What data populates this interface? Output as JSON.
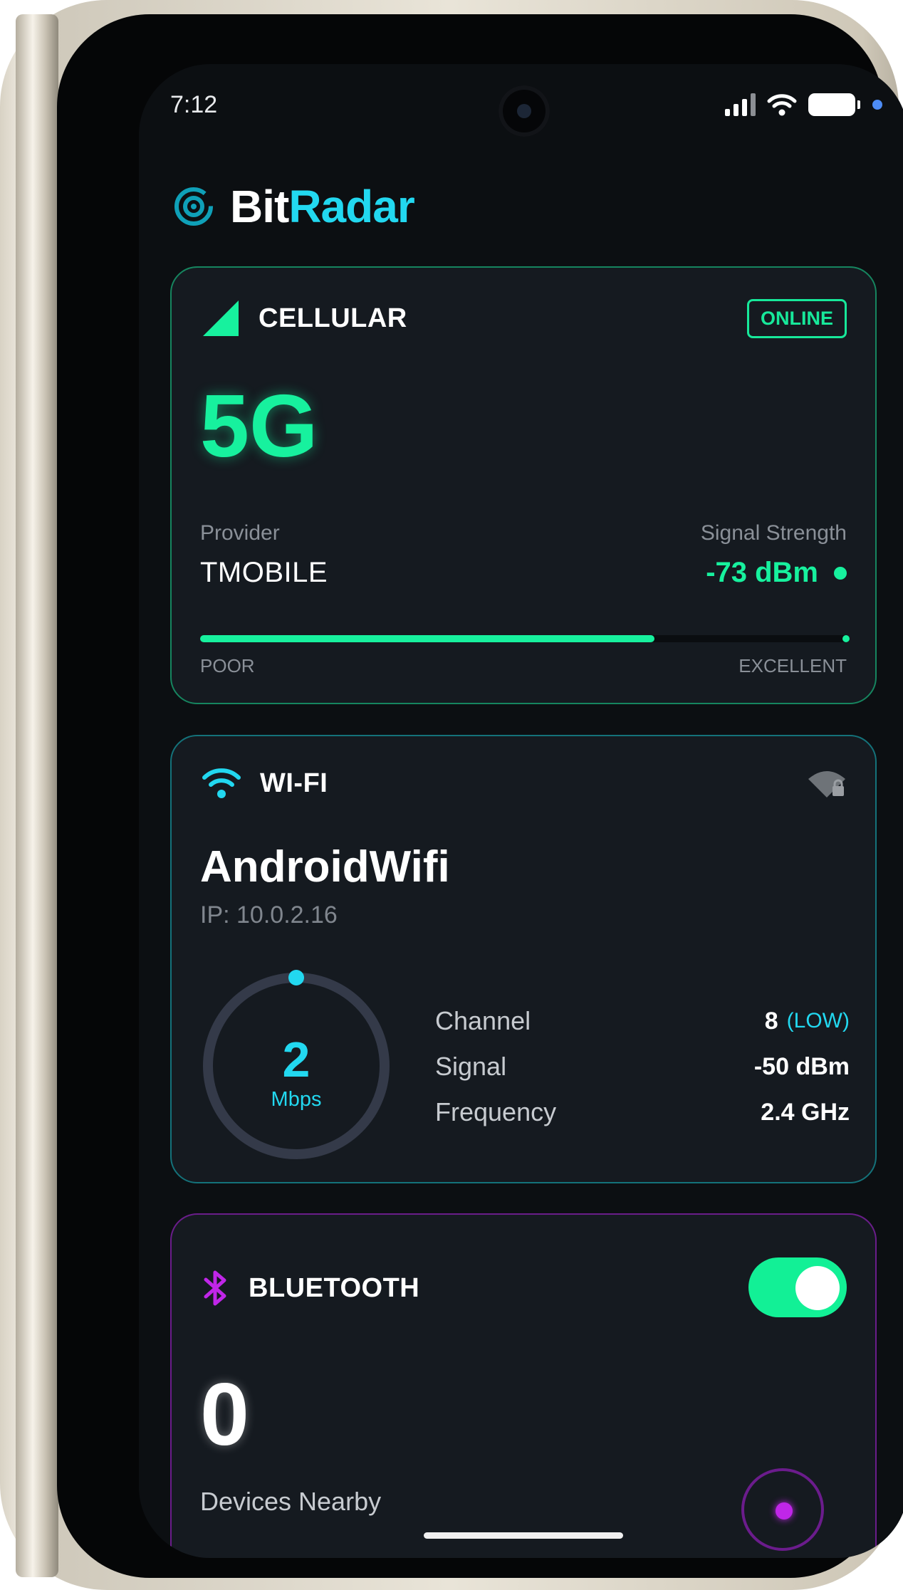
{
  "status_bar": {
    "time": "7:12"
  },
  "app": {
    "title_part1": "Bit",
    "title_part2": "Radar",
    "accent_color": "#22d8f0",
    "logo_icon": "radar-icon"
  },
  "cellular": {
    "title": "CELLULAR",
    "status_badge": "ONLINE",
    "network_type": "5G",
    "provider_label": "Provider",
    "provider_value": "TMOBILE",
    "signal_label": "Signal Strength",
    "signal_value": "-73 dBm",
    "signal_quality_fraction": 0.7,
    "scale_min_label": "POOR",
    "scale_max_label": "EXCELLENT",
    "accent_color": "#17f19e"
  },
  "wifi": {
    "title": "WI-FI",
    "ssid": "AndroidWifi",
    "ip": "IP: 10.0.2.16",
    "speed_value": "2",
    "speed_unit": "Mbps",
    "stats": [
      {
        "label": "Channel",
        "value": "8",
        "tag": "(LOW)"
      },
      {
        "label": "Signal",
        "value": "-50 dBm"
      },
      {
        "label": "Frequency",
        "value": "2.4 GHz"
      }
    ],
    "accent_color": "#22d8f0"
  },
  "bluetooth": {
    "title": "BLUETOOTH",
    "enabled": true,
    "device_count": "0",
    "device_label": "Devices Nearby",
    "accent_color": "#c026e8"
  }
}
